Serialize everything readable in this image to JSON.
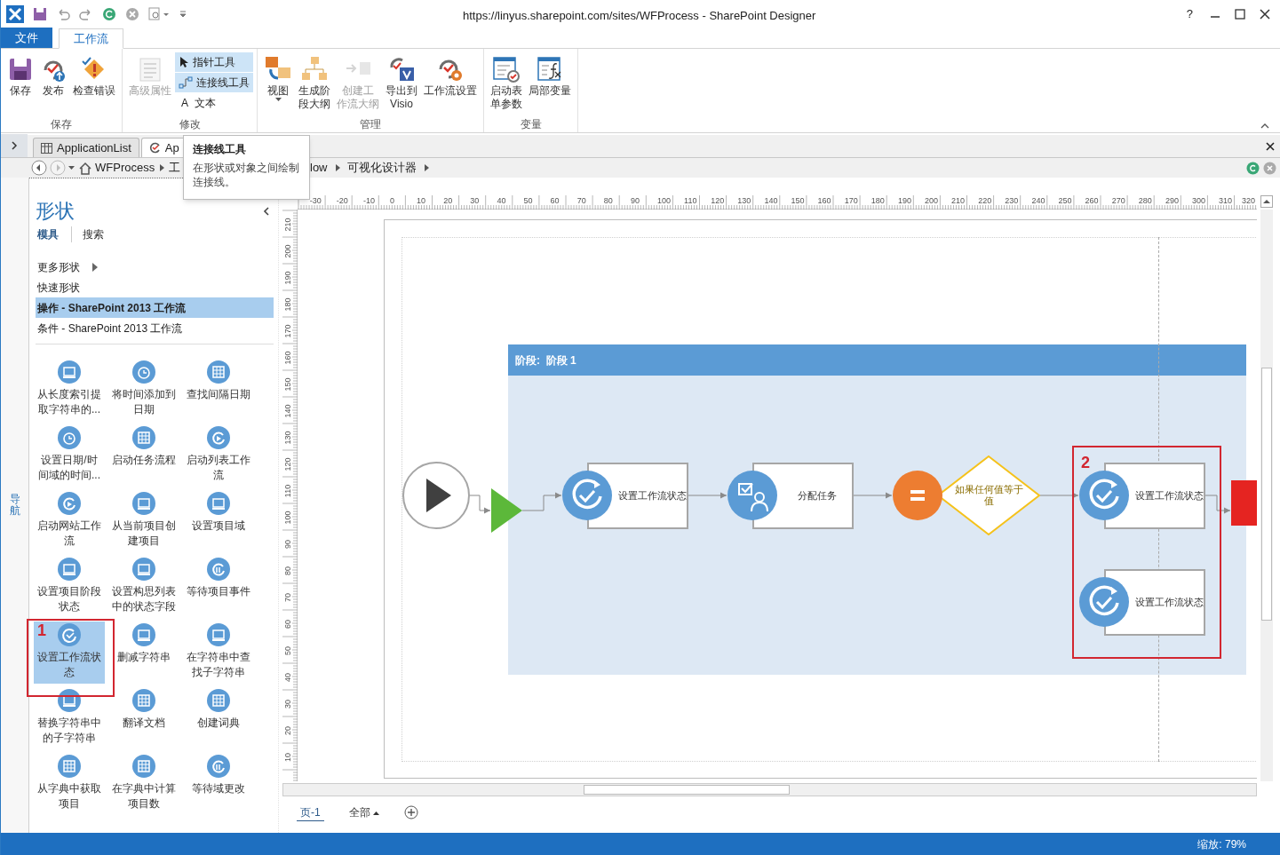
{
  "title_bar": {
    "title": "https://linyus.sharepoint.com/sites/WFProcess - SharePoint Designer",
    "help": "?"
  },
  "ribbon": {
    "tabs": [
      {
        "label": "文件",
        "kind": "file",
        "selected": false
      },
      {
        "label": "工作流",
        "kind": "tab",
        "selected": true
      }
    ],
    "groups": [
      {
        "label": "保存",
        "buttons": [
          {
            "kind": "large",
            "lines": [
              "保存"
            ],
            "disabled": false,
            "dropdown": false
          },
          {
            "kind": "large",
            "lines": [
              "发布"
            ],
            "disabled": false,
            "dropdown": false
          },
          {
            "kind": "large",
            "lines": [
              "检查错误"
            ],
            "disabled": false,
            "dropdown": false
          }
        ]
      },
      {
        "label": "修改",
        "buttons": [
          {
            "kind": "large",
            "lines": [
              "高级属性"
            ],
            "disabled": true,
            "dropdown": false
          },
          {
            "kind": "small",
            "lines": [
              "指针工具"
            ],
            "highlighted": true
          },
          {
            "kind": "small",
            "lines": [
              "连接线工具"
            ],
            "highlighted": true
          },
          {
            "kind": "small",
            "lines": [
              "文本"
            ],
            "highlighted": false,
            "glyph": "A"
          }
        ]
      },
      {
        "label": "管理",
        "buttons": [
          {
            "kind": "large",
            "lines": [
              "视图"
            ],
            "disabled": false,
            "dropdown": true
          },
          {
            "kind": "large",
            "lines": [
              "生成阶",
              "段大纲"
            ],
            "disabled": false,
            "dropdown": false
          },
          {
            "kind": "large",
            "lines": [
              "创建工",
              "作流大纲"
            ],
            "disabled": true,
            "dropdown": false
          },
          {
            "kind": "large",
            "lines": [
              "导出到",
              "Visio"
            ],
            "disabled": false,
            "dropdown": false
          },
          {
            "kind": "large",
            "lines": [
              "工作流设置"
            ],
            "disabled": false,
            "dropdown": false
          }
        ]
      },
      {
        "label": "变量",
        "buttons": [
          {
            "kind": "large",
            "lines": [
              "启动表",
              "单参数"
            ],
            "disabled": false,
            "dropdown": false
          },
          {
            "kind": "large",
            "lines": [
              "局部变量"
            ],
            "disabled": false,
            "dropdown": false
          }
        ]
      }
    ]
  },
  "doc_tabs": [
    {
      "label": "ApplicationList",
      "selected": false
    },
    {
      "label": "Ap",
      "selected": true
    }
  ],
  "breadcrumb": [
    "WFProcess",
    "工",
    "low",
    "可视化设计器"
  ],
  "tooltip": {
    "title": "连接线工具",
    "text": "在形状或对象之间绘制连接线。"
  },
  "nav_pane": {
    "label": "导航"
  },
  "shapes_panel": {
    "title": "形状",
    "tabs": [
      {
        "label": "模具",
        "selected": true
      },
      {
        "label": "搜索",
        "selected": false
      }
    ],
    "sections": [
      {
        "label": "更多形状",
        "kind": "submenu",
        "selected": false
      },
      {
        "label": "快速形状",
        "kind": "item",
        "selected": false
      },
      {
        "label": "操作 - SharePoint 2013 工作流",
        "kind": "item",
        "selected": true
      },
      {
        "label": "条件 - SharePoint 2013 工作流",
        "kind": "item",
        "selected": false
      }
    ],
    "stencils": [
      {
        "lines": [
          "从长度索引提",
          "取字符串的..."
        ],
        "selected": false
      },
      {
        "lines": [
          "将时间添加到",
          "日期"
        ],
        "selected": false
      },
      {
        "lines": [
          "查找间隔日期"
        ],
        "selected": false
      },
      {
        "lines": [
          "设置日期/时",
          "间域的时间..."
        ],
        "selected": false
      },
      {
        "lines": [
          "启动任务流程"
        ],
        "selected": false
      },
      {
        "lines": [
          "启动列表工作",
          "流"
        ],
        "selected": false
      },
      {
        "lines": [
          "启动网站工作",
          "流"
        ],
        "selected": false
      },
      {
        "lines": [
          "从当前项目创",
          "建项目"
        ],
        "selected": false
      },
      {
        "lines": [
          "设置项目域"
        ],
        "selected": false
      },
      {
        "lines": [
          "设置项目阶段",
          "状态"
        ],
        "selected": false
      },
      {
        "lines": [
          "设置构思列表",
          "中的状态字段"
        ],
        "selected": false
      },
      {
        "lines": [
          "等待项目事件"
        ],
        "selected": false
      },
      {
        "lines": [
          "设置工作流状",
          "态"
        ],
        "selected": true
      },
      {
        "lines": [
          "删减字符串"
        ],
        "selected": false
      },
      {
        "lines": [
          "在字符串中查",
          "找子字符串"
        ],
        "selected": false
      },
      {
        "lines": [
          "替换字符串中",
          "的子字符串"
        ],
        "selected": false
      },
      {
        "lines": [
          "翻译文档"
        ],
        "selected": false
      },
      {
        "lines": [
          "创建词典"
        ],
        "selected": false
      },
      {
        "lines": [
          "从字典中获取",
          "项目"
        ],
        "selected": false
      },
      {
        "lines": [
          "在字典中计算",
          "项目数"
        ],
        "selected": false
      },
      {
        "lines": [
          "等待域更改"
        ],
        "selected": false
      }
    ]
  },
  "rulers": {
    "horizontal": [
      "-30",
      "-20",
      "-10",
      "0",
      "10",
      "20",
      "30",
      "40",
      "50",
      "60",
      "70",
      "80",
      "90",
      "100",
      "110",
      "120",
      "130",
      "140",
      "150",
      "160",
      "170",
      "180",
      "190",
      "200",
      "210",
      "220",
      "230",
      "240",
      "250",
      "260",
      "270",
      "280",
      "290",
      "300",
      "310",
      "320"
    ],
    "vertical": [
      "210",
      "200",
      "190",
      "180",
      "170",
      "160",
      "150",
      "140",
      "130",
      "120",
      "110",
      "100",
      "90",
      "80",
      "70",
      "60",
      "50",
      "40",
      "30",
      "20",
      "10"
    ]
  },
  "diagram": {
    "stage": {
      "label": "阶段:  阶段 1"
    },
    "nodes": [
      {
        "kind": "action",
        "lines": [
          "设置工作流状态"
        ]
      },
      {
        "kind": "task",
        "lines": [
          "分配任务"
        ]
      },
      {
        "kind": "condition",
        "lines": [
          "如果任何值等于",
          "值"
        ]
      },
      {
        "kind": "action",
        "lines": [
          "设置工作流状态"
        ]
      },
      {
        "kind": "action",
        "lines": [
          "设置工作流状态"
        ]
      }
    ]
  },
  "annotations": [
    {
      "label": "1"
    },
    {
      "label": "2"
    }
  ],
  "page_tabs": [
    {
      "label": "页-1",
      "kind": "page",
      "selected": true
    },
    {
      "label": "全部",
      "kind": "dropdown",
      "selected": false
    }
  ],
  "status_bar": {
    "zoom": "缩放: 79%"
  }
}
